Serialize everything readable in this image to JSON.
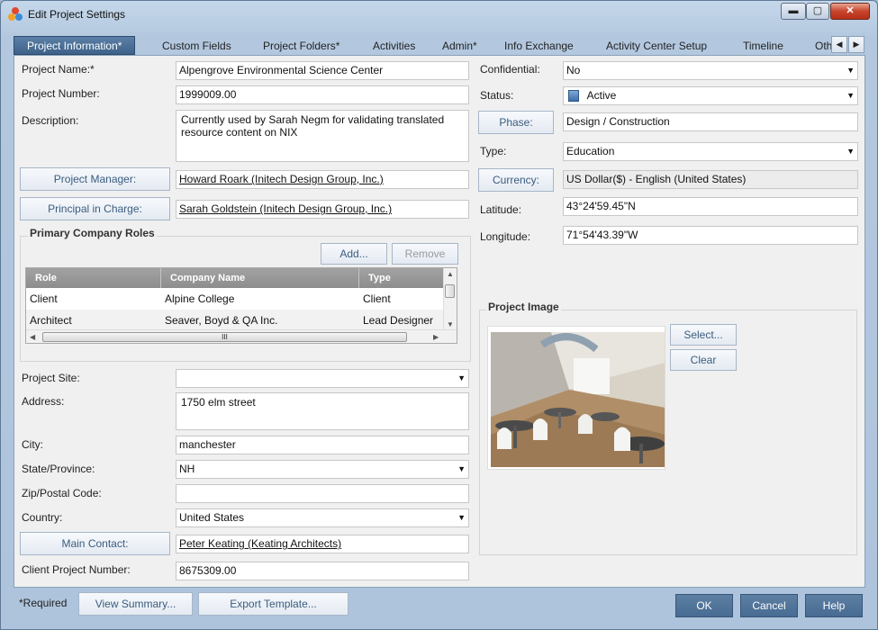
{
  "window": {
    "title": "Edit Project Settings",
    "controls": {
      "minimize": "▬",
      "maximize": "▢",
      "close": "✕"
    }
  },
  "tabs": [
    {
      "label": "Project Information*",
      "active": true
    },
    {
      "label": "Custom Fields"
    },
    {
      "label": "Project Folders*"
    },
    {
      "label": "Activities"
    },
    {
      "label": "Admin*"
    },
    {
      "label": "Info Exchange"
    },
    {
      "label": "Activity Center Setup"
    },
    {
      "label": "Timeline"
    },
    {
      "label": "Oth"
    }
  ],
  "tab_scroll": {
    "left": "◀",
    "right": "▶"
  },
  "left": {
    "project_name": {
      "label": "Project Name:*",
      "value": "Alpengrove Environmental Science Center"
    },
    "project_number": {
      "label": "Project Number:",
      "value": "1999009.00"
    },
    "description": {
      "label": "Description:",
      "value": "Currently used by Sarah Negm for validating translated resource content on NIX"
    },
    "project_manager": {
      "button": "Project Manager:",
      "value": "Howard Roark (Initech Design Group, Inc.)"
    },
    "principal": {
      "button": "Principal in Charge:",
      "value": "Sarah Goldstein (Initech Design Group, Inc.)"
    },
    "roles": {
      "title": "Primary Company Roles",
      "add": "Add...",
      "remove": "Remove",
      "columns": [
        "Role",
        "Company Name",
        "Type"
      ],
      "rows": [
        [
          "Client",
          "Alpine College",
          "Client"
        ],
        [
          "Architect",
          "Seaver, Boyd & QA Inc.",
          "Lead Designer"
        ]
      ],
      "scroll_grip": "III"
    },
    "project_site": {
      "label": "Project Site:",
      "value": ""
    },
    "address": {
      "label": "Address:",
      "value": "1750 elm street"
    },
    "city": {
      "label": "City:",
      "value": "manchester"
    },
    "state": {
      "label": "State/Province:",
      "value": "NH"
    },
    "zip": {
      "label": "Zip/Postal Code:",
      "value": ""
    },
    "country": {
      "label": "Country:",
      "value": "United States"
    },
    "main_contact": {
      "button": "Main Contact:",
      "value": "Peter Keating (Keating Architects)"
    },
    "client_project_number": {
      "label": "Client Project Number:",
      "value": "8675309.00"
    }
  },
  "right": {
    "confidential": {
      "label": "Confidential:",
      "value": "No"
    },
    "status": {
      "label": "Status:",
      "value": "Active"
    },
    "phase": {
      "button": "Phase:",
      "value": "Design / Construction"
    },
    "type": {
      "label": "Type:",
      "value": "Education"
    },
    "currency": {
      "button": "Currency:",
      "value": "US Dollar($) - English (United States)"
    },
    "latitude": {
      "label": "Latitude:",
      "value": "43°24'59.45\"N"
    },
    "longitude": {
      "label": "Longitude:",
      "value": "71°54'43.39\"W"
    },
    "image": {
      "title": "Project Image",
      "select": "Select...",
      "clear": "Clear"
    }
  },
  "footer": {
    "required_note": "*Required",
    "view_summary": "View Summary...",
    "export_template": "Export Template...",
    "ok": "OK",
    "cancel": "Cancel",
    "help": "Help"
  },
  "icons": {
    "dropdown": "▼",
    "scroll_up": "▲",
    "scroll_down": "▼",
    "scroll_left": "◀",
    "scroll_right": "▶"
  }
}
